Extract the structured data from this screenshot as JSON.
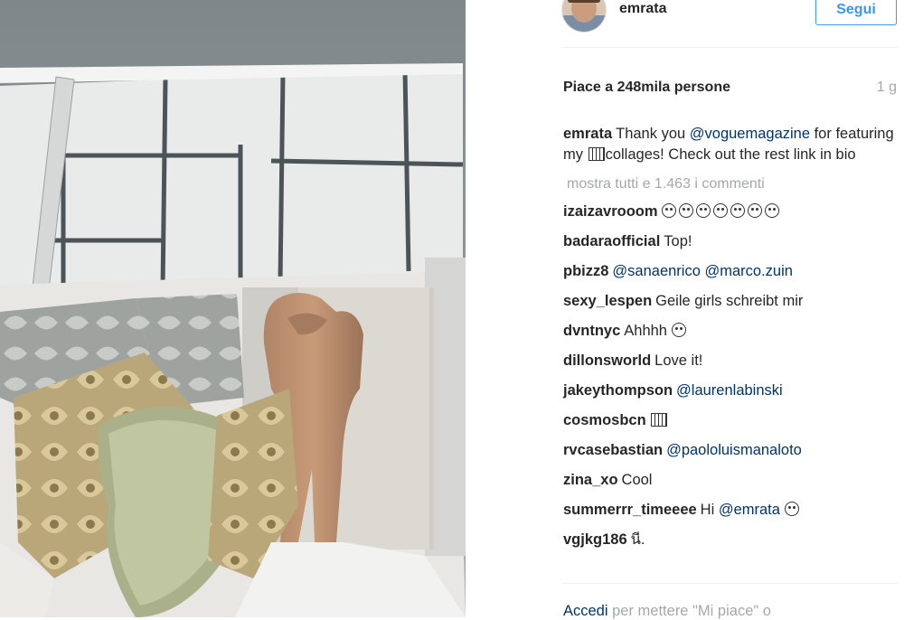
{
  "post": {
    "username": "emrata",
    "follow_label": "Segui",
    "likes": "Piace a 248mila persone",
    "time": "1 g",
    "caption": {
      "username": "emrata",
      "text_1": "Thank you ",
      "mention": "@voguemagazine",
      "text_2": " for featuring my ",
      "text_3": "collages! Check out the rest link in bio"
    },
    "show_all": "mostra tutti e 1.463 i commenti",
    "comments": [
      {
        "user": "izaizavrooom",
        "text": "",
        "mention": "",
        "emoji": 7
      },
      {
        "user": "badaraofficial",
        "text": "Top!",
        "mention": ""
      },
      {
        "user": "pbizz8",
        "text": "",
        "mention": "@sanaenrico @marco.zuin"
      },
      {
        "user": "sexy_lespen",
        "text": "Geile girls schreibt mir",
        "mention": ""
      },
      {
        "user": "dvntnyc",
        "text": "Ahhhh",
        "mention": "",
        "emoji": 1
      },
      {
        "user": "dillonsworld",
        "text": "Love it!",
        "mention": ""
      },
      {
        "user": "jakeythompson",
        "text": "",
        "mention": "@laurenlabinski"
      },
      {
        "user": "cosmosbcn",
        "text": "",
        "mention": "",
        "glyph": true
      },
      {
        "user": "rvcasebastian",
        "text": "",
        "mention": "@paololuismanaloto"
      },
      {
        "user": "zina_xo",
        "text": "Cool",
        "mention": ""
      },
      {
        "user": "summerrr_timeeee",
        "text": "Hi ",
        "mention": "@emrata",
        "emoji": 1
      },
      {
        "user": "vgjkg186",
        "text": "นี.",
        "mention": ""
      }
    ],
    "footer": {
      "login": "Accedi",
      "rest": " per mettere \"Mi piace\" o"
    }
  },
  "colors": {
    "link": "#003569",
    "follow_blue": "#3897f0",
    "muted": "#a5a7aa",
    "text": "#262626"
  },
  "icons": [
    "smiley-emoji-icon",
    "missing-glyph-icon"
  ]
}
